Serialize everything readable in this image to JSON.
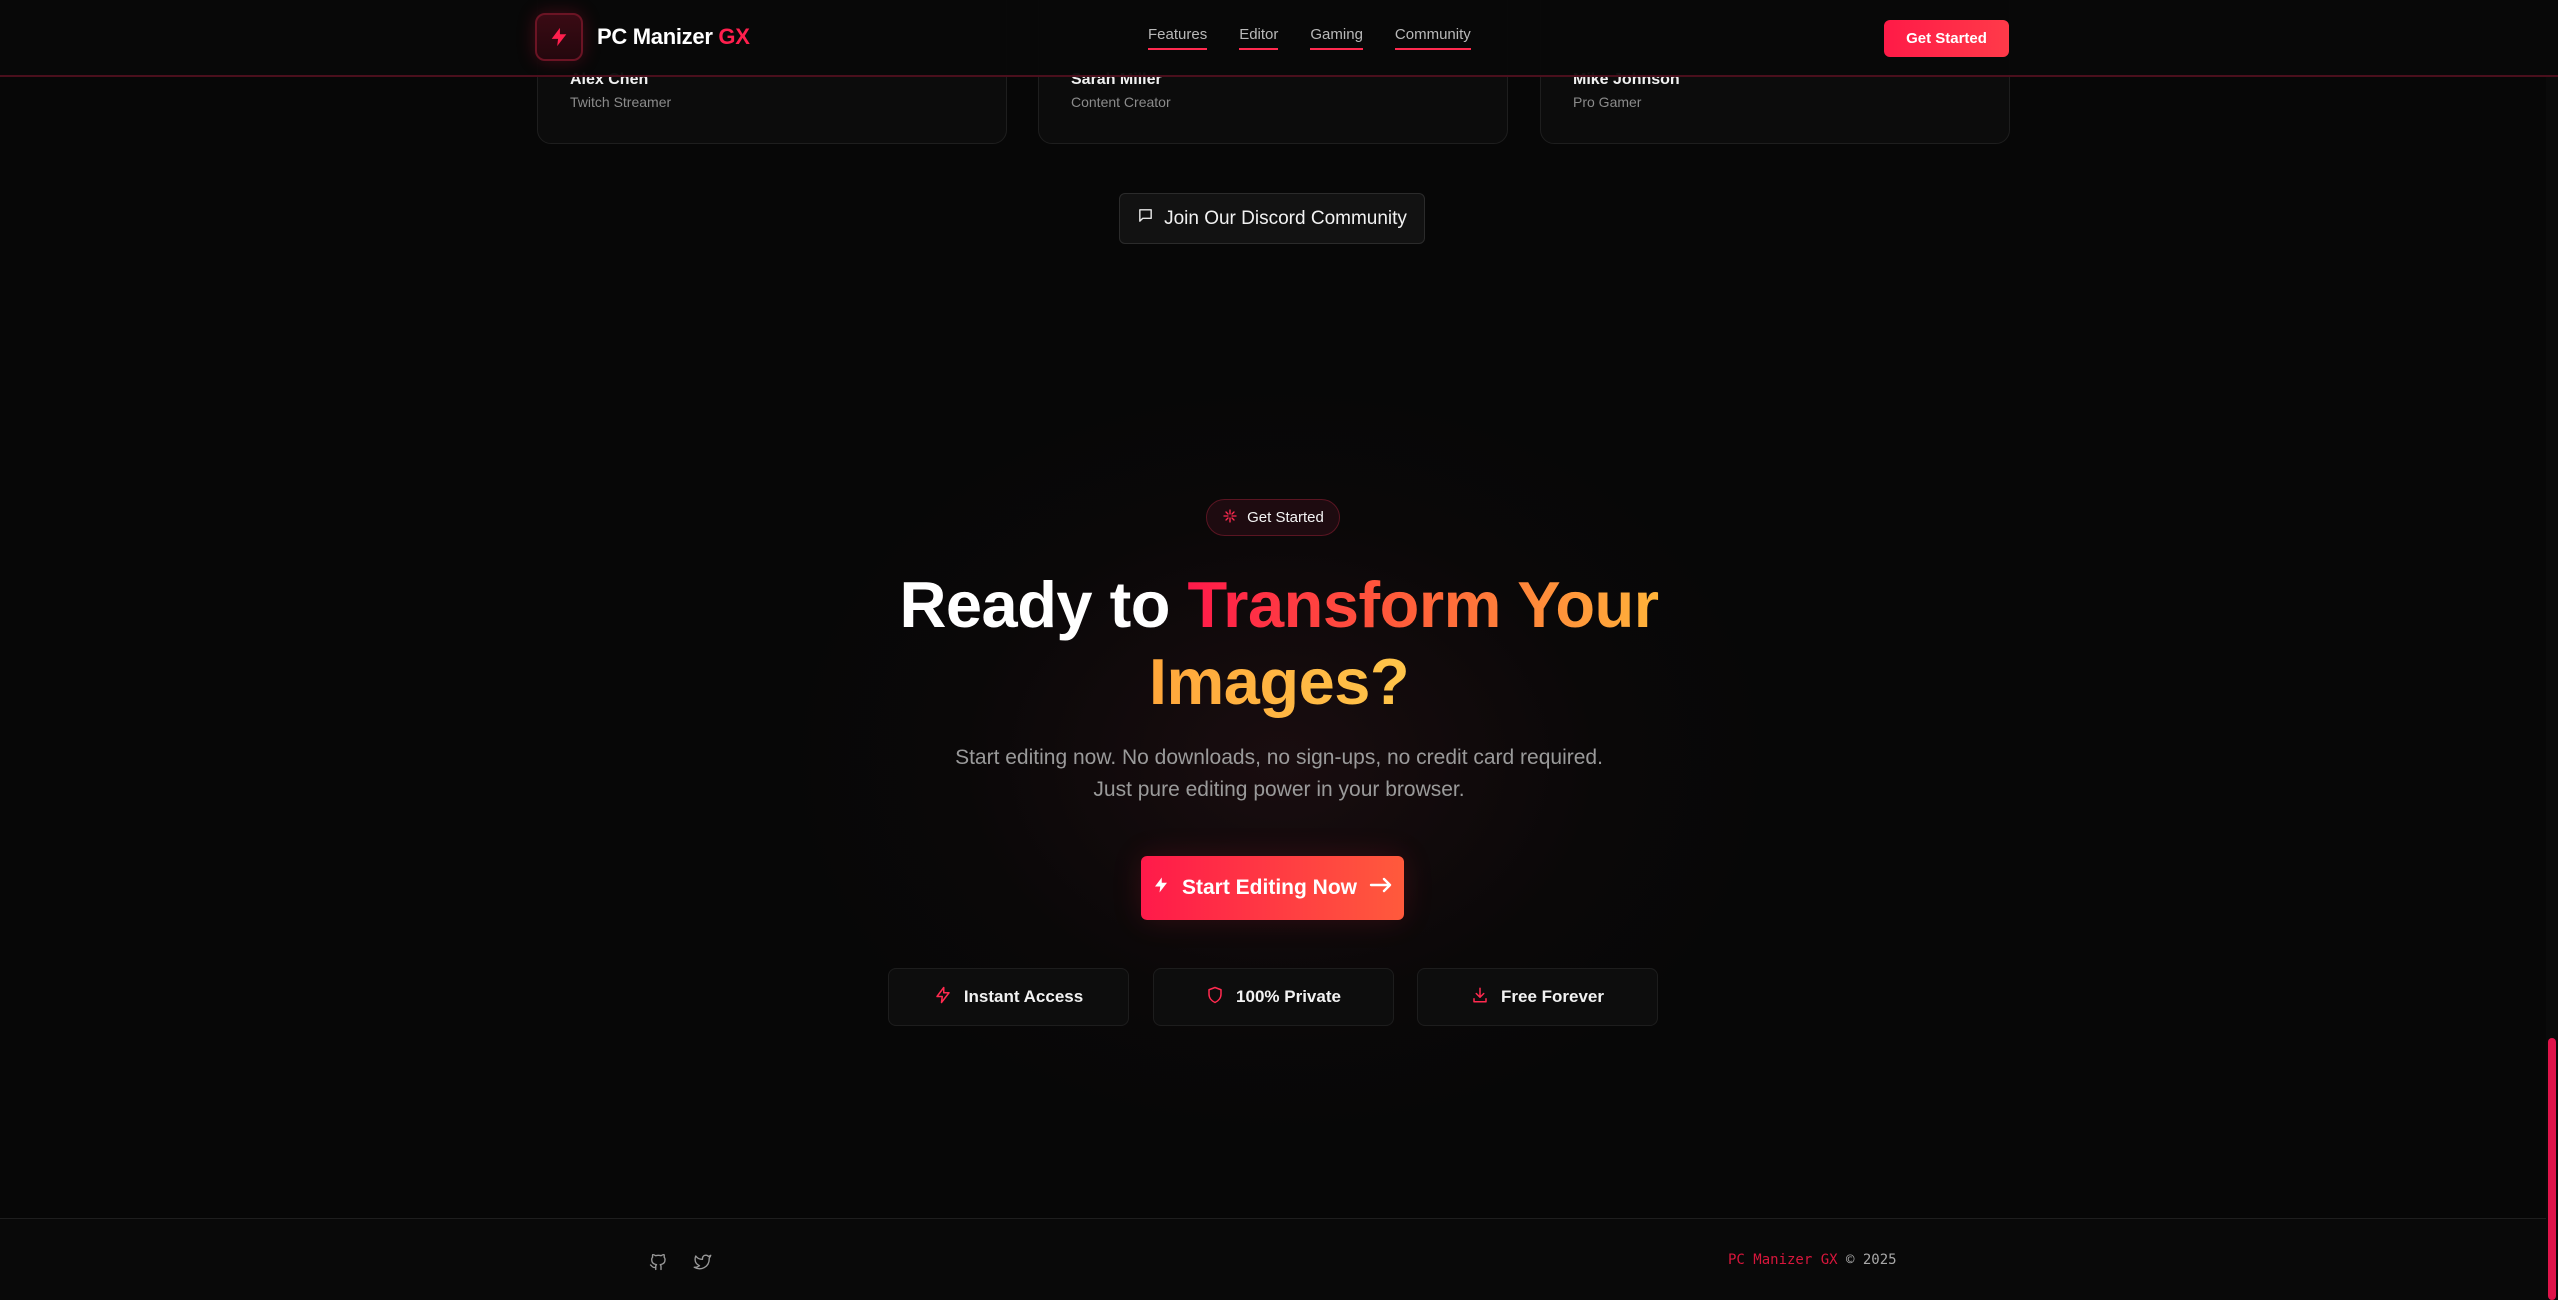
{
  "nav": {
    "brand_name": "PC Manizer",
    "brand_accent": "GX",
    "links": [
      {
        "label": "Features"
      },
      {
        "label": "Editor"
      },
      {
        "label": "Gaming"
      },
      {
        "label": "Community"
      }
    ],
    "cta_label": "Get Started"
  },
  "testimonials": [
    {
      "name": "Alex Chen",
      "role": "Twitch Streamer"
    },
    {
      "name": "Sarah Miller",
      "role": "Content Creator"
    },
    {
      "name": "Mike Johnson",
      "role": "Pro Gamer"
    }
  ],
  "discord": {
    "label": "Join Our Discord Community",
    "icon": "message-square-icon"
  },
  "cta": {
    "badge": "Get Started",
    "badge_icon": "sparkles-icon",
    "headline_part1": "Ready to",
    "headline_part2": "Transform Your",
    "headline_part3": "Images?",
    "subtext_line1": "Start editing now. No downloads, no sign-ups, no credit card required.",
    "subtext_line2": "Just pure editing power in your browser.",
    "button_label": "Start Editing Now",
    "button_icons": [
      "zap-icon",
      "arrow-right-icon"
    ],
    "features": [
      {
        "label": "Instant Access",
        "icon": "zap-icon"
      },
      {
        "label": "100% Private",
        "icon": "shield-icon"
      },
      {
        "label": "Free Forever",
        "icon": "download-icon"
      }
    ]
  },
  "footer": {
    "social": [
      {
        "icon": "github-icon"
      },
      {
        "icon": "twitter-icon"
      }
    ],
    "copyright_brand": "PC Manizer GX",
    "copyright_rest": "© 2025"
  },
  "colors": {
    "accent": "#ff1f4d",
    "background": "#070707",
    "gradient_end": "#ffb43a"
  }
}
